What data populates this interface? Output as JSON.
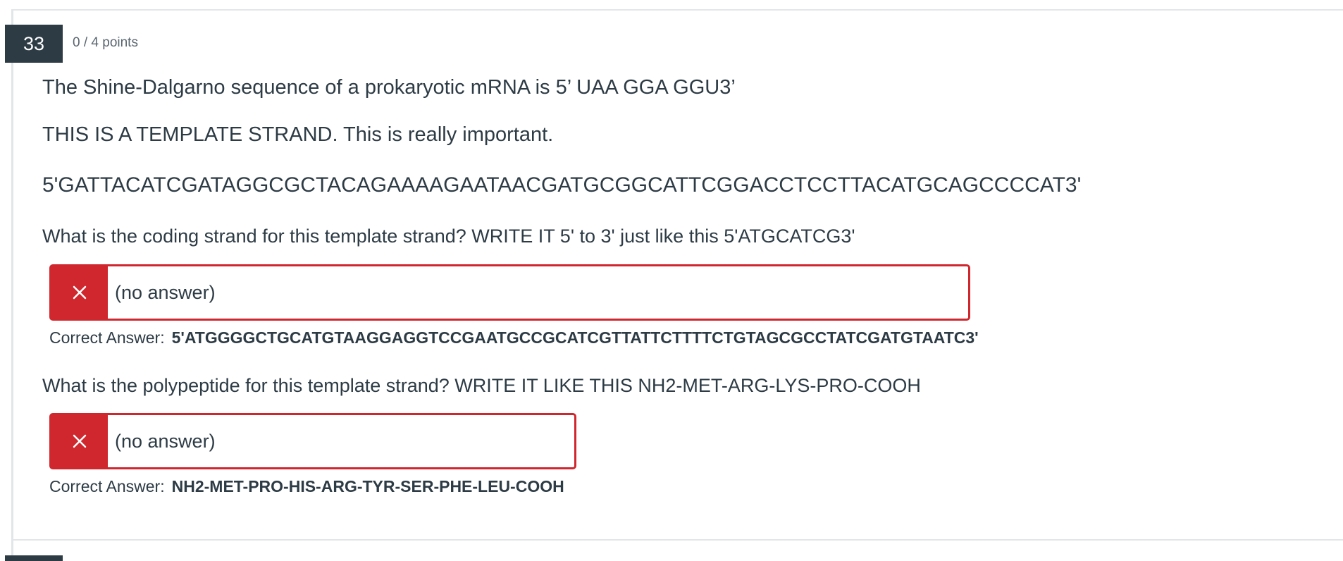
{
  "question": {
    "number": "33",
    "points": "0 / 4 points",
    "statements": [
      "The Shine-Dalgarno sequence of a prokaryotic mRNA is 5’ UAA GGA GGU3’",
      "THIS IS A TEMPLATE STRAND.  This is really important.",
      "5'GATTACATCGATAGGCGCTACAGAAAAGAATAACGATGCGGCATTCGGACCTCCTTACATGCAGCCCCAT3'"
    ],
    "parts": [
      {
        "prompt": "What is the coding strand for this template strand? WRITE IT 5' to 3' just like this 5'ATGCATCG3'",
        "answer": "(no answer)",
        "correct_label": "Correct Answer:",
        "correct_value": "5'ATGGGGCTGCATGTAAGGAGGTCCGAATGCCGCATCGTTATTCTTTTCTGTAGCGCCTATCGATGTAATC3'"
      },
      {
        "prompt": "What is the polypeptide for this template strand? WRITE IT LIKE THIS NH2-MET-ARG-LYS-PRO-COOH",
        "answer": "(no answer)",
        "correct_label": "Correct Answer:",
        "correct_value": "NH2-MET-PRO-HIS-ARG-TYR-SER-PHE-LEU-COOH"
      }
    ]
  },
  "icons": {
    "incorrect": "close-icon"
  },
  "colors": {
    "incorrect": "#d0262d",
    "header_bg": "#2d3b45",
    "text": "#2d3b45"
  }
}
